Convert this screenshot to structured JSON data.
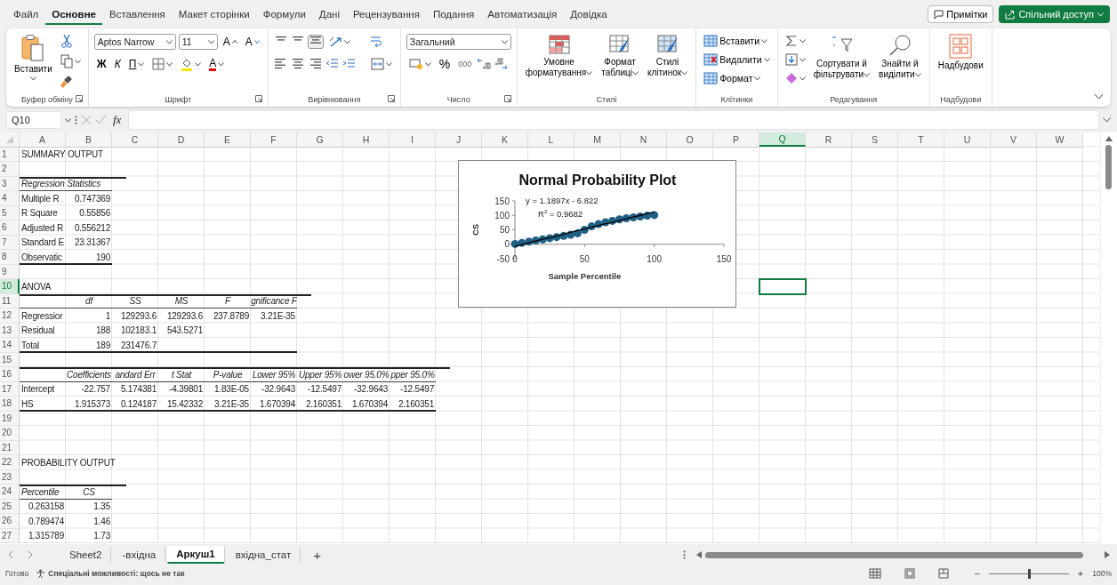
{
  "menu_tabs": [
    {
      "label": "Файл",
      "selected": false
    },
    {
      "label": "Основне",
      "selected": true
    },
    {
      "label": "Вставлення",
      "selected": false
    },
    {
      "label": "Макет сторінки",
      "selected": false
    },
    {
      "label": "Формули",
      "selected": false
    },
    {
      "label": "Дані",
      "selected": false
    },
    {
      "label": "Рецензування",
      "selected": false
    },
    {
      "label": "Подання",
      "selected": false
    },
    {
      "label": "Автоматизація",
      "selected": false
    },
    {
      "label": "Довідка",
      "selected": false
    }
  ],
  "comments_button": "Примітки",
  "share_button": "Спільний доступ",
  "ribbon": [
    {
      "kind": "clipboard",
      "title": "Буфер обміну",
      "paste": "Вставити"
    },
    {
      "kind": "font",
      "title": "Шрифт",
      "font_name": "Aptos Narrow",
      "font_size": "11",
      "grow": "A",
      "shrink": "A",
      "bold": "Ж",
      "italic": "К",
      "underline": "П",
      "font_color": "A"
    },
    {
      "kind": "alignment",
      "title": "Вирівнювання"
    },
    {
      "kind": "number",
      "title": "Число",
      "format": "Загальний",
      "percent": "%",
      "thousands": "000"
    },
    {
      "kind": "styles",
      "title": "Стилі",
      "buttons": [
        [
          "Умовне",
          "форматування"
        ],
        [
          "Формат",
          "таблиці"
        ],
        [
          "Стилі",
          "клітинок"
        ]
      ]
    },
    {
      "kind": "cells",
      "title": "Клітинки",
      "buttons": [
        "Вставити",
        "Видалити",
        "Формат"
      ]
    },
    {
      "kind": "editing",
      "title": "Редагування",
      "buttons": [
        [
          "Сортувати й",
          "фільтрувати"
        ],
        [
          "Знайти й",
          "виділити"
        ]
      ]
    },
    {
      "kind": "addins",
      "title": "Надбудови",
      "button": "Надбудови"
    }
  ],
  "formula_bar": {
    "name_box": "Q10",
    "function_label": "fx"
  },
  "columns": [
    {
      "label": "A",
      "selected": false
    },
    {
      "label": "B",
      "selected": false
    },
    {
      "label": "C",
      "selected": false
    },
    {
      "label": "D",
      "selected": false
    },
    {
      "label": "E",
      "selected": false
    },
    {
      "label": "F",
      "selected": false
    },
    {
      "label": "G",
      "selected": false
    },
    {
      "label": "H",
      "selected": false
    },
    {
      "label": "I",
      "selected": false
    },
    {
      "label": "J",
      "selected": false
    },
    {
      "label": "K",
      "selected": false
    },
    {
      "label": "L",
      "selected": false
    },
    {
      "label": "M",
      "selected": false
    },
    {
      "label": "N",
      "selected": false
    },
    {
      "label": "O",
      "selected": false
    },
    {
      "label": "P",
      "selected": false
    },
    {
      "label": "Q",
      "selected": true
    },
    {
      "label": "R",
      "selected": false
    },
    {
      "label": "S",
      "selected": false
    },
    {
      "label": "T",
      "selected": false
    },
    {
      "label": "U",
      "selected": false
    },
    {
      "label": "V",
      "selected": false
    },
    {
      "label": "W",
      "selected": false
    }
  ],
  "rows": [
    {
      "num": "1",
      "selected": false,
      "kind": "title",
      "cells": [
        "SUMMARY OUTPUT"
      ]
    },
    {
      "num": "2",
      "selected": false,
      "kind": "data"
    },
    {
      "num": "3",
      "selected": false,
      "kind": "header",
      "top_border": true,
      "header_underline": true,
      "cells": [
        "Regression Statistics",
        null
      ]
    },
    {
      "num": "4",
      "selected": false,
      "kind": "data",
      "cells": [
        "Multiple R",
        "0.747369"
      ]
    },
    {
      "num": "5",
      "selected": false,
      "kind": "data",
      "cells": [
        "R Square",
        "0.55856"
      ]
    },
    {
      "num": "6",
      "selected": false,
      "kind": "data",
      "cells": [
        "Adjusted R",
        "0.556212"
      ]
    },
    {
      "num": "7",
      "selected": false,
      "kind": "data",
      "cells": [
        "Standard E",
        "23.31367"
      ]
    },
    {
      "num": "8",
      "selected": false,
      "kind": "data",
      "bottom_border": true,
      "cells": [
        "Observatic",
        "190"
      ]
    },
    {
      "num": "9",
      "selected": false,
      "kind": "data"
    },
    {
      "num": "10",
      "selected": true,
      "kind": "title",
      "cells": [
        "ANOVA"
      ]
    },
    {
      "num": "11",
      "selected": false,
      "kind": "header",
      "top_border": true,
      "header_underline": true,
      "cells": [
        null,
        "df",
        "SS",
        "MS",
        "F",
        "gnificance F"
      ]
    },
    {
      "num": "12",
      "selected": false,
      "kind": "data",
      "cells": [
        "Regressior",
        "1",
        "129293.6",
        "129293.6",
        "237.8789",
        "3.21E-35"
      ]
    },
    {
      "num": "13",
      "selected": false,
      "kind": "data",
      "cells": [
        "Residual",
        "188",
        "102183.1",
        "543.5271"
      ]
    },
    {
      "num": "14",
      "selected": false,
      "kind": "data",
      "bottom_border": true,
      "cells": [
        "Total",
        "189",
        "231476.7",
        null,
        null,
        null
      ]
    },
    {
      "num": "15",
      "selected": false,
      "kind": "data"
    },
    {
      "num": "16",
      "selected": false,
      "kind": "header",
      "top_border": true,
      "header_underline": true,
      "cells": [
        null,
        "Coefficients",
        "andard Err",
        "t Stat",
        "P-value",
        "Lower 95%",
        "Upper 95%",
        "ower 95.0%",
        "pper 95.0%"
      ]
    },
    {
      "num": "17",
      "selected": false,
      "kind": "data",
      "cells": [
        "Intercept",
        "-22.757",
        "5.174381",
        "-4.39801",
        "1.83E-05",
        "-32.9643",
        "-12.5497",
        "-32.9643",
        "-12.5497"
      ]
    },
    {
      "num": "18",
      "selected": false,
      "kind": "data",
      "bottom_border": true,
      "cells": [
        "HS",
        "1.915373",
        "0.124187",
        "15.42332",
        "3.21E-35",
        "1.670394",
        "2.160351",
        "1.670394",
        "2.160351"
      ]
    },
    {
      "num": "19",
      "selected": false,
      "kind": "data"
    },
    {
      "num": "20",
      "selected": false,
      "kind": "data"
    },
    {
      "num": "21",
      "selected": false,
      "kind": "data"
    },
    {
      "num": "22",
      "selected": false,
      "kind": "title",
      "cells": [
        "PROBABILITY OUTPUT"
      ]
    },
    {
      "num": "23",
      "selected": false,
      "kind": "data"
    },
    {
      "num": "24",
      "selected": false,
      "kind": "header",
      "top_border": true,
      "header_underline": true,
      "cells": [
        "Percentile",
        "CS"
      ]
    },
    {
      "num": "25",
      "selected": false,
      "kind": "prob",
      "cells": [
        "0.263158",
        "1.35"
      ]
    },
    {
      "num": "26",
      "selected": false,
      "kind": "prob",
      "cells": [
        "0.789474",
        "1.46"
      ]
    },
    {
      "num": "27",
      "selected": false,
      "kind": "prob",
      "cells": [
        "1.315789",
        "1.73"
      ]
    }
  ],
  "chart": {
    "chart_data": {
      "type": "scatter",
      "title": "Normal Probability Plot",
      "xlabel": "Sample Percentile",
      "ylabel": "CS",
      "xlim": [
        0,
        150
      ],
      "ylim": [
        -50,
        150
      ],
      "xticks": [
        0,
        50,
        100,
        150
      ],
      "yticks": [
        -50,
        0,
        50,
        100,
        150
      ],
      "x": [
        0,
        5,
        10,
        15,
        20,
        25,
        30,
        35,
        40,
        45,
        50,
        55,
        60,
        65,
        70,
        75,
        80,
        85,
        90,
        95,
        100
      ],
      "series": [
        {
          "color": "#1f6085",
          "values": [
            1,
            5,
            9,
            13,
            17,
            21,
            25,
            29,
            33,
            38,
            50,
            62,
            70,
            76,
            81,
            86,
            90,
            93,
            96,
            99,
            101
          ]
        },
        {
          "color": "#000000",
          "type": "line",
          "values": [
            -7,
            -1,
            5,
            11,
            17,
            23,
            29,
            35,
            41,
            47,
            53,
            59,
            65,
            71,
            76,
            82,
            88,
            94,
            100,
            106,
            112
          ]
        }
      ],
      "annotations": [
        {
          "text": "y = 1.1897x - 6.822"
        },
        {
          "text": "R$^{2}$ = 0.9682"
        }
      ]
    }
  },
  "sheet_tabs": [
    {
      "label": "Sheet2",
      "selected": false
    },
    {
      "label": "-вхідна",
      "selected": false
    },
    {
      "label": "Аркуш1",
      "selected": true
    },
    {
      "label": "вхідна_стат",
      "selected": false
    }
  ],
  "add_sheet": "+",
  "status_bar": {
    "ready": "Готово",
    "accessibility": "Спеціальні можливості: щось не так",
    "zoom_minus": "−",
    "zoom_plus": "+",
    "zoom": {
      "level": 0.5
    },
    "zoom_percent": "100%"
  }
}
